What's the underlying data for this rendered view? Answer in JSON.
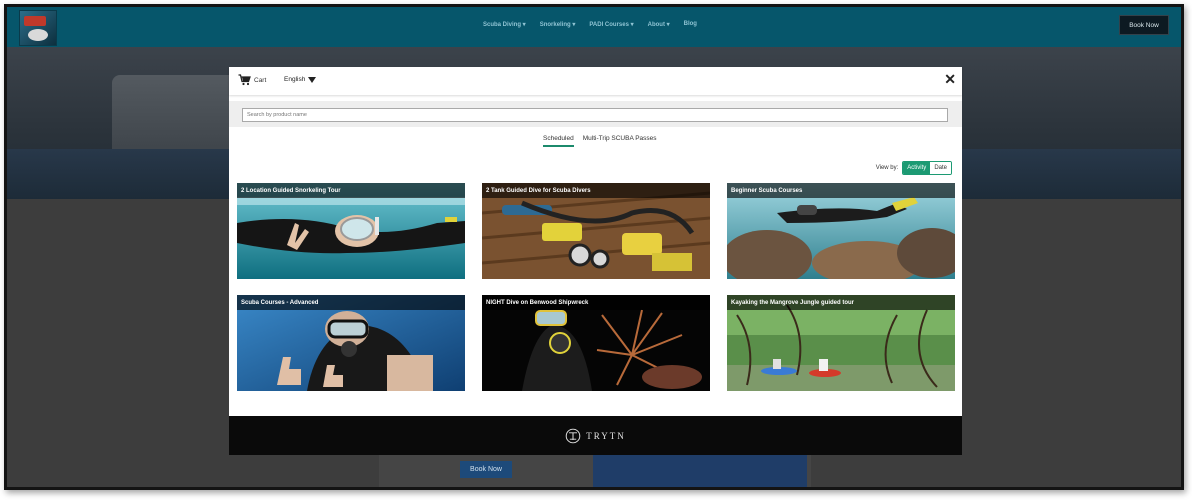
{
  "site": {
    "nav_links": [
      "Scuba Diving ▾",
      "Snorkeling ▾",
      "PADI Courses ▾",
      "About ▾",
      "Blog"
    ],
    "book_now_label": "Book Now",
    "book_now_label_2": "Book Now"
  },
  "modal": {
    "cart_label": "Cart",
    "language_label": "English",
    "close_label": "✕",
    "search_placeholder": "Search by product name",
    "tabs": [
      {
        "label": "Scheduled",
        "active": true
      },
      {
        "label": "Multi-Trip SCUBA Passes",
        "active": false
      }
    ],
    "view_by_label": "View by:",
    "view_options": [
      {
        "label": "Activity",
        "selected": true
      },
      {
        "label": "Date",
        "selected": false
      }
    ],
    "products": [
      {
        "title": "2 Location Guided Snorkeling Tour",
        "scene": "snorkel"
      },
      {
        "title": "2 Tank Guided Dive for Scuba Divers",
        "scene": "gear"
      },
      {
        "title": "Beginner Scuba Courses",
        "scene": "reef"
      },
      {
        "title": "Scuba Courses - Advanced",
        "scene": "thumbsup"
      },
      {
        "title": "NIGHT Dive on Benwood Shipwreck",
        "scene": "night"
      },
      {
        "title": "Kayaking the Mangrove Jungle guided tour",
        "scene": "mangrove"
      }
    ],
    "footer_brand": "TRYTN"
  },
  "colors": {
    "accent": "#1c9a73",
    "nav_bg": "#06566b",
    "footer_bg": "#0a0a0a"
  }
}
